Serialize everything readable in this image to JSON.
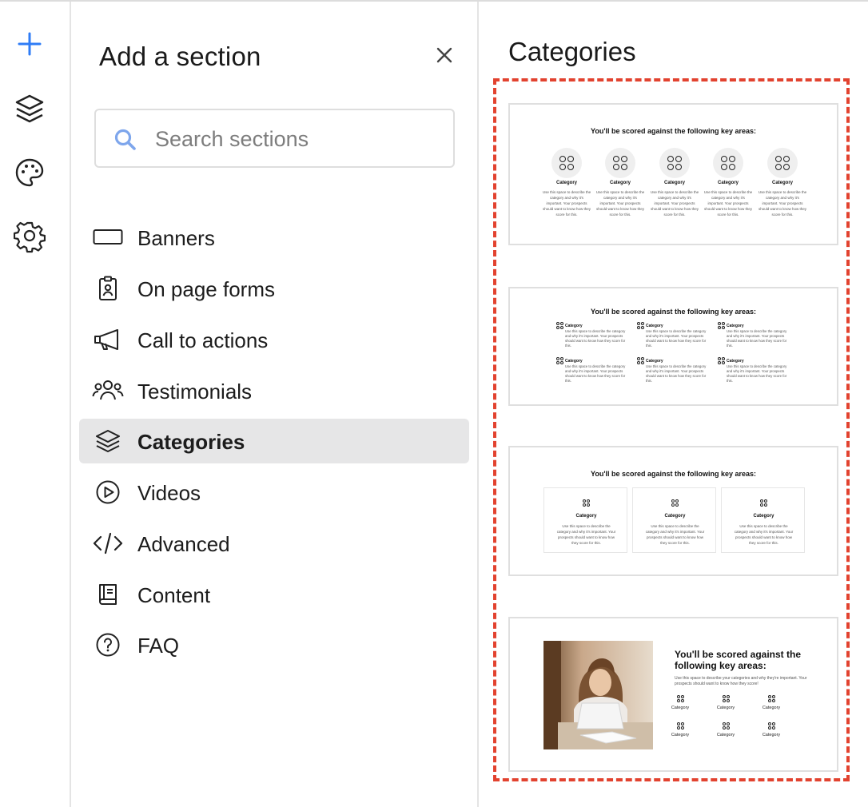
{
  "rail": {
    "items": [
      {
        "name": "add-icon"
      },
      {
        "name": "layers-icon"
      },
      {
        "name": "palette-icon"
      },
      {
        "name": "gear-icon"
      }
    ]
  },
  "panel": {
    "title": "Add a section",
    "search_placeholder": "Search sections",
    "items": [
      {
        "label": "Banners",
        "icon": "banner-icon"
      },
      {
        "label": "On page forms",
        "icon": "clipboard-icon"
      },
      {
        "label": "Call to actions",
        "icon": "megaphone-icon"
      },
      {
        "label": "Testimonials",
        "icon": "people-icon"
      },
      {
        "label": "Categories",
        "icon": "layers-icon",
        "active": true
      },
      {
        "label": "Videos",
        "icon": "play-icon"
      },
      {
        "label": "Advanced",
        "icon": "code-icon"
      },
      {
        "label": "Content",
        "icon": "book-icon"
      },
      {
        "label": "FAQ",
        "icon": "question-icon"
      }
    ]
  },
  "content": {
    "title": "Categories",
    "templates": [
      {
        "heading": "You'll be scored against the following key areas:",
        "label": "Category",
        "desc_lines": [
          "Use this space to",
          "describe the category",
          "and why it's important.",
          "Your prospects should",
          "want to know how they",
          "score for this."
        ]
      },
      {
        "heading": "You'll be scored against the following key areas:",
        "label": "Category",
        "desc": "Use this space to describe the category and why it's important. Your prospects should want to know how they score for this."
      },
      {
        "heading": "You'll be scored against the following key areas:",
        "label": "Category",
        "desc": "Use this space to describe the category and why it's important. Your prospects should want to know how they score for this."
      },
      {
        "heading": "You'll be scored against the following key areas:",
        "desc": "Use this space to describe your categories and why they're important. Your prospects should want to know how they score!",
        "label": "Category"
      }
    ]
  },
  "colors": {
    "accent": "#3b82f6",
    "highlight_border": "#e2422f",
    "active_bg": "#e6e6e7"
  }
}
